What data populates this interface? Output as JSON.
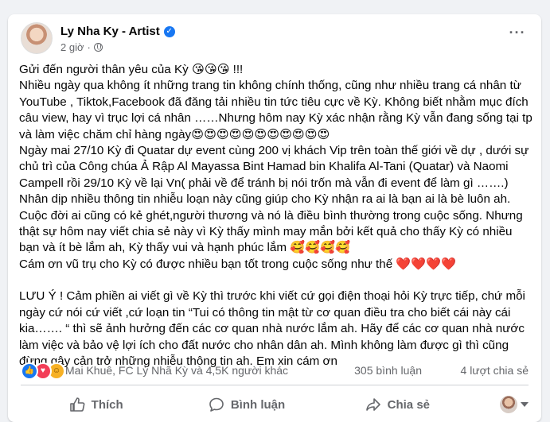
{
  "post": {
    "author": "Ly Nha Ky - Artist",
    "time": "2 giờ",
    "paragraphs": [
      "Gửi đến người thân yêu của Kỳ 😘😘😘 !!!\nNhiều ngày qua không ít những trang tin không chính thống,  cũng như nhiều trang  cá nhân từ YouTube , Tiktok,Facebook đã đăng tải nhiều tin tức tiêu  cực về Kỳ. Không biết nhằm mục đích câu view, hay vì trục lợi cá nhân ……Nhưng hôm nay Kỳ xác nhận rằng Kỳ vẫn đang sống tại tp và làm việc chăm chỉ hàng ngày😍😍😍😍😍😍😍😍😍😍😍\nNgày mai 27/10 Kỳ đi Quatar dự event cùng 200 vị khách Vip trên toàn thế giới về dự , dưới sự chủ trì của Công chúa Ả Rập Al Mayassa Bint Hamad bin Khalifa Al-Tani (Quatar) và Naomi Campell  rồi 29/10 Kỳ về lại Vn( phải về để tránh bị nói trốn mà vẫn đi event để làm gì …….)\nNhân dịp nhiều thông tin nhiễu loạn này cũng giúp cho Kỳ nhận ra  ai là bạn ai là bè luôn ah.\nCuộc đời ai cũng có kẻ ghét,người thương và nó là điều bình thường trong cuộc sống. Nhưng thật sự hôm nay viết chia sẻ này vì Kỳ thấy mình may mắn bởi  kết quả cho thấy Kỳ có nhiều bạn và ít bè lắm ah, Kỳ thấy vui và hạnh phúc lắm 🥰🥰🥰🥰\nCám ơn vũ trụ cho Kỳ có được nhiều bạn tốt trong cuộc sống như thế ❤️❤️❤️❤️",
      "LƯU Ý ! Cảm phiền ai viết gì về Kỳ thì trước khi viết cứ gọi điện thoại hỏi Kỳ trực tiếp, chứ mỗi ngày cứ nói cứ viết ,cứ loạn tin “Tui có  thông tin mật từ cơ quan điều tra cho biết cái này cái kia……. “ thì sẽ ảnh hưởng đến các cơ quan nhà nước lắm ah. Hãy để các cơ quan nhà nước làm việc và bảo vệ lợi ích cho đất nước cho nhân dân ah. Mình không làm được gì thì cũng đừng gây cản trở những nhiễu thông tin ah. Em xin cám ơn"
    ]
  },
  "stats": {
    "reactors": "Mai Khuê, FC Lý Nhã Kỳ và 4,5K người khác",
    "comments": "305 bình luận",
    "shares": "4 lượt chia sẻ"
  },
  "actions": {
    "like": "Thích",
    "comment": "Bình luận",
    "share": "Chia sẻ"
  },
  "colors": {
    "like_blue": "#1877f2",
    "love_red": "#f33e58",
    "care_yellow": "#f7b125",
    "secondary_text": "#65676b"
  },
  "icons": {
    "verified": "verified-badge-icon",
    "privacy": "globe-icon",
    "more": "more-options-icon",
    "like": "thumbs-up-icon",
    "comment": "comment-bubble-icon",
    "share": "share-arrow-icon"
  }
}
